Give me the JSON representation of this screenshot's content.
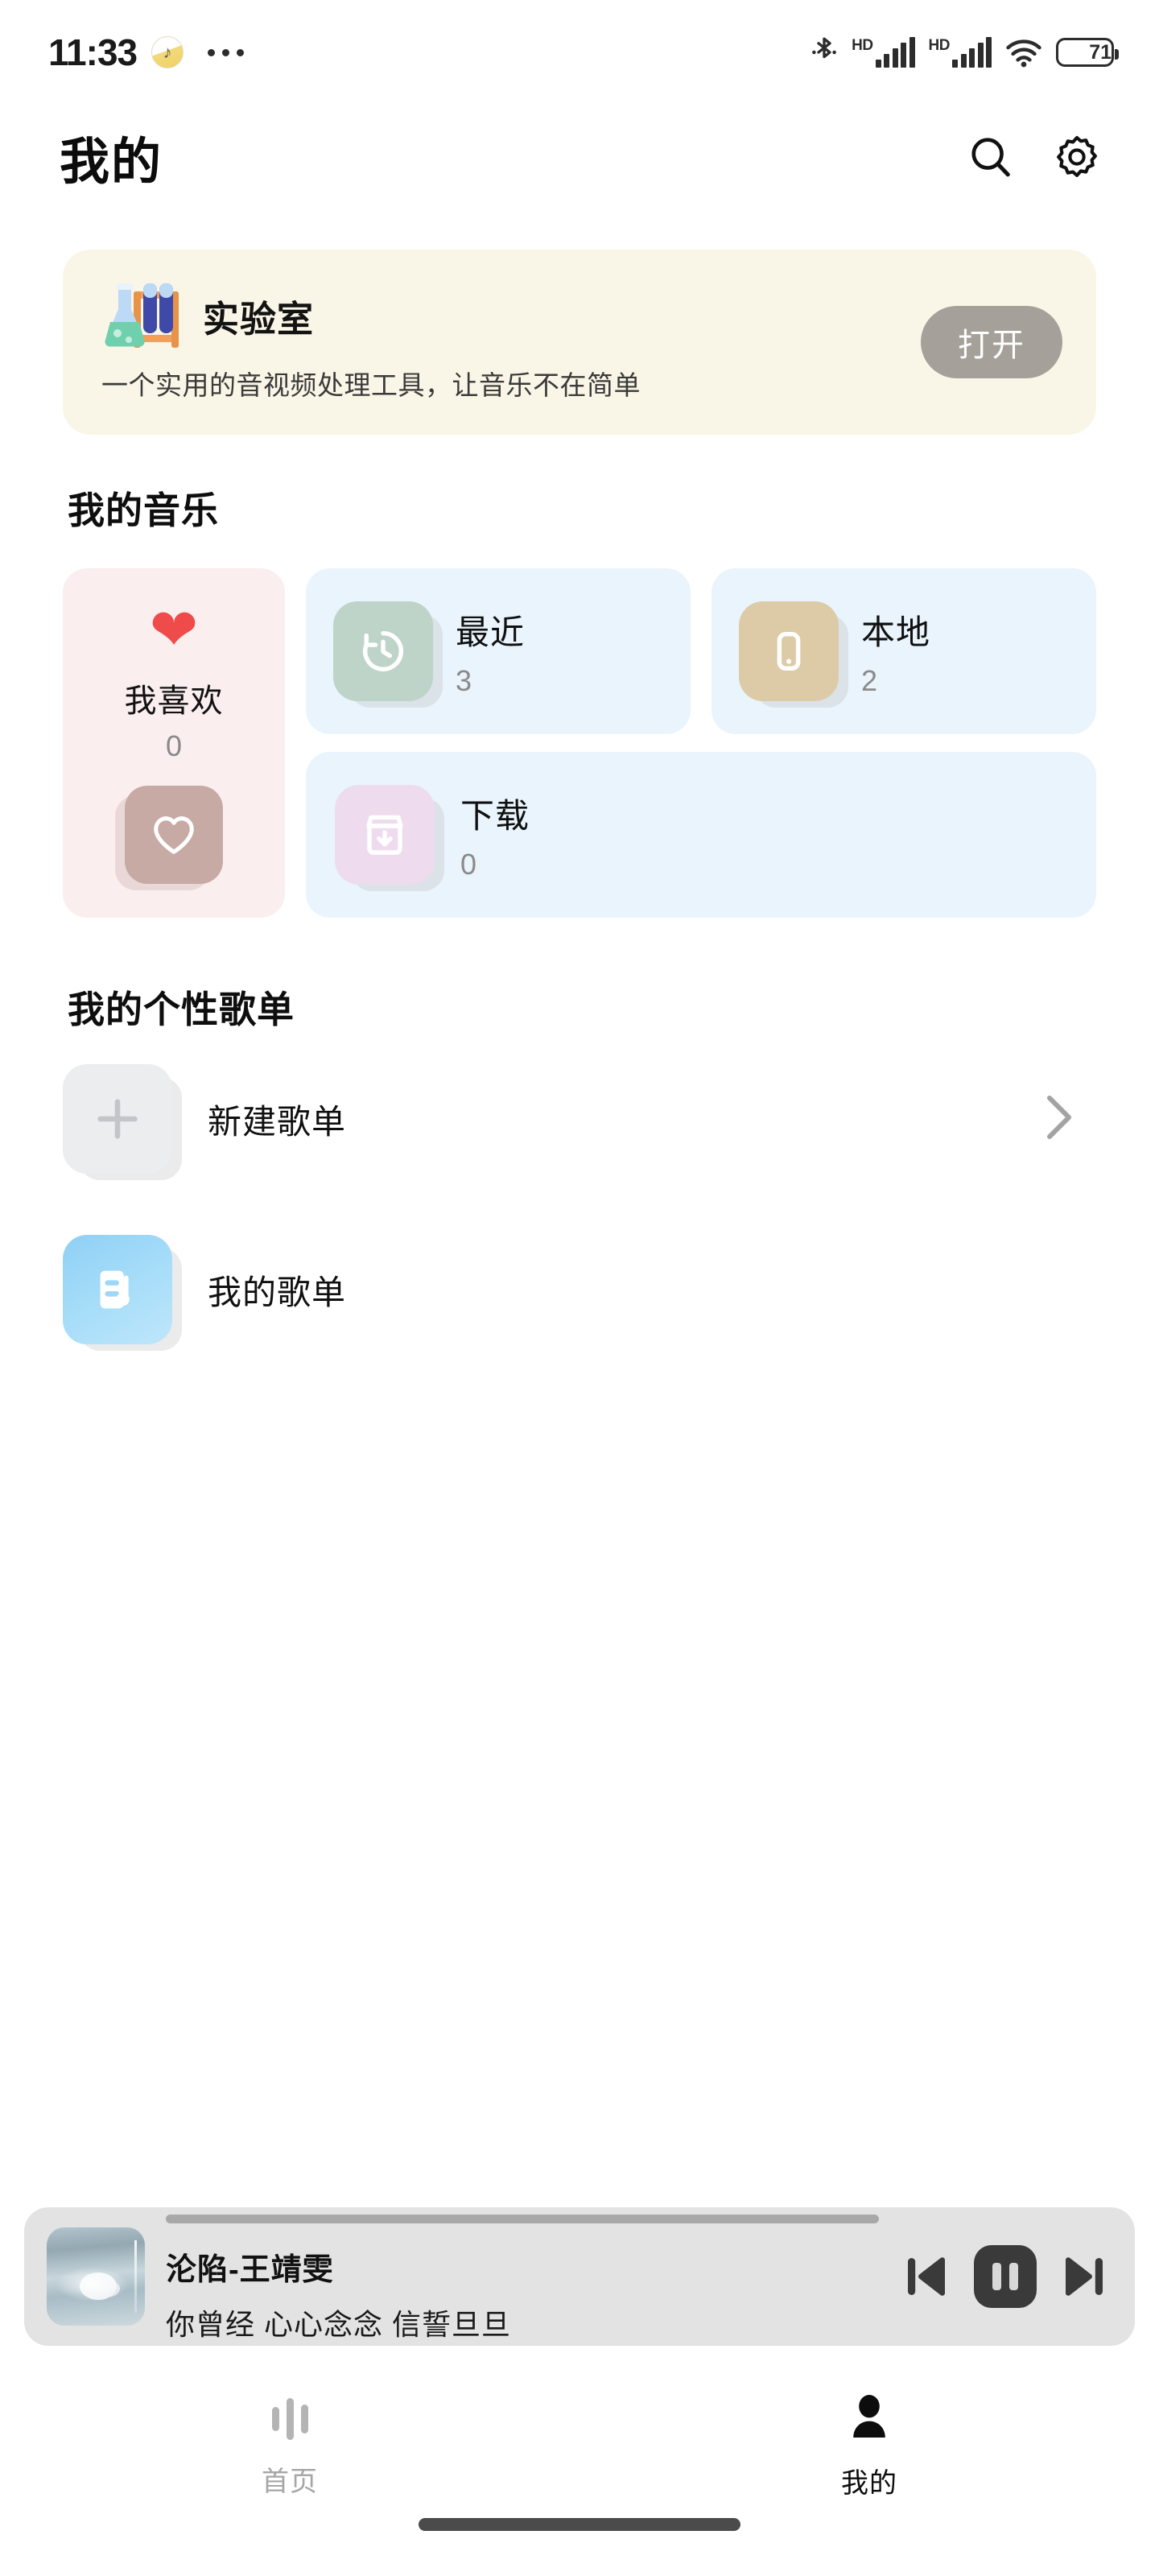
{
  "statusbar": {
    "time": "11:33",
    "music_badge_icon": "music-note-icon",
    "more_icon": "more-dots-icon",
    "bluetooth_icon": "bluetooth-icon",
    "hd_label_1": "HD",
    "hd_label_2": "HD",
    "wifi_icon": "wifi-icon",
    "battery_percent": "71"
  },
  "header": {
    "title": "我的",
    "search_icon": "search-icon",
    "settings_icon": "gear-icon"
  },
  "lab_banner": {
    "icon": "lab-flask-icon",
    "title": "实验室",
    "subtitle": "一个实用的音视频处理工具，让音乐不在简单",
    "button_label": "打开",
    "bg_color": "#faf6e7",
    "button_color": "#a5a099"
  },
  "my_music": {
    "section_title": "我的音乐",
    "favorites": {
      "label": "我喜欢",
      "count": "0",
      "heart_icon": "heart-filled-icon",
      "tile_icon": "heart-outline-icon",
      "bg_color": "#fbeeee",
      "tile_color": "#c8aaa4",
      "heart_color": "#ef4b4b"
    },
    "cards": [
      {
        "label": "最近",
        "count": "3",
        "icon": "clock-history-icon",
        "tile_color": "#bed4c8",
        "bg_color": "#eaf4fd"
      },
      {
        "label": "本地",
        "count": "2",
        "icon": "phone-icon",
        "tile_color": "#dccba6",
        "bg_color": "#eaf4fd"
      },
      {
        "label": "下载",
        "count": "0",
        "icon": "download-box-icon",
        "tile_color": "#eedcee",
        "bg_color": "#eaf4fd"
      }
    ]
  },
  "playlists": {
    "section_title": "我的个性歌单",
    "items": [
      {
        "label": "新建歌单",
        "icon": "plus-icon",
        "has_chevron": true
      },
      {
        "label": "我的歌单",
        "icon": "playlist-music-icon",
        "has_chevron": false
      }
    ],
    "chevron_icon": "chevron-right-icon"
  },
  "mini_player": {
    "title": "沦陷-王靖雯",
    "lyric": "你曾经 心心念念 信誓旦旦",
    "progress_percent": 28,
    "album_art": "album-art-butterfly",
    "prev_icon": "skip-previous-icon",
    "pause_icon": "pause-icon",
    "next_icon": "skip-next-icon"
  },
  "bottom_nav": {
    "items": [
      {
        "label": "首页",
        "icon": "equalizer-icon",
        "active": false
      },
      {
        "label": "我的",
        "icon": "person-icon",
        "active": true
      }
    ]
  }
}
